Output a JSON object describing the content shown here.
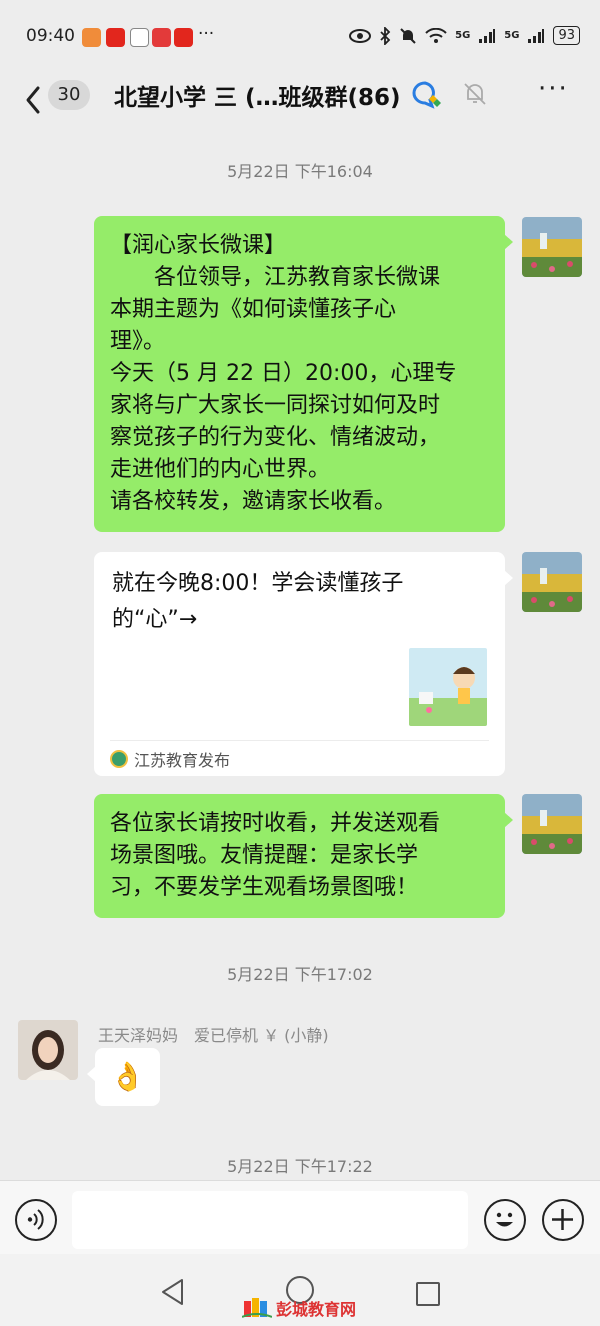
{
  "status_bar": {
    "time": "09:40",
    "dots": "···",
    "signal_1": "5G",
    "signal_2": "5G",
    "battery": "93"
  },
  "header": {
    "unread_count": "30",
    "title": "北望小学 三 (…班级群(86)"
  },
  "messages": {
    "ts1": "5月22日 下午16:04",
    "msg1": {
      "line1": "【润心家长微课】",
      "line2": "各位领导，江苏教育家长微课",
      "line3": "本期主题为《如何读懂孩子心",
      "line4": "理》。",
      "line5": "今天（5 月 22 日）20:00，心理专",
      "line6": "家将与广大家长一同探讨如何及时",
      "line7": "察觉孩子的行为变化、情绪波动，",
      "line8": "走进他们的内心世界。",
      "line9": "请各校转发，邀请家长收看。"
    },
    "card": {
      "title": "就在今晚8:00！学会读懂孩子的“心”→",
      "source": "江苏教育发布"
    },
    "msg3": {
      "line1": "各位家长请按时收看，并发送观看",
      "line2": "场景图哦。友情提醒：是家长学",
      "line3": "习，不要发学生观看场景图哦！"
    },
    "ts2": "5月22日 下午17:02",
    "msg4": {
      "sender": "王天泽妈妈　爱已停机 ￥ (小静)",
      "content": "👌"
    },
    "ts3": "5月22日 下午17:22"
  },
  "watermark": "彭城教育网",
  "colors": {
    "background": "#ededed",
    "self_bubble": "#95ec69",
    "other_bubble": "#ffffff"
  }
}
